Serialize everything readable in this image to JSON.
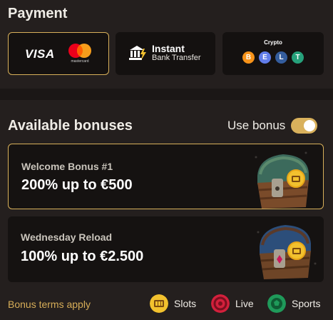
{
  "payment": {
    "title": "Payment",
    "methods": [
      {
        "id": "cards",
        "visa": "VISA",
        "mastercard": "mastercard",
        "selected": true
      },
      {
        "id": "bank",
        "title": "Instant",
        "subtitle": "Bank Transfer",
        "selected": false
      },
      {
        "id": "crypto",
        "title": "Crypto",
        "coins": [
          "B",
          "E",
          "L",
          "T"
        ],
        "selected": false
      }
    ]
  },
  "bonuses": {
    "title": "Available bonuses",
    "use_bonus_label": "Use bonus",
    "use_bonus_enabled": true,
    "items": [
      {
        "name": "Welcome Bonus #1",
        "value": "200% up to €500",
        "selected": true
      },
      {
        "name": "Wednesday Reload",
        "value": "100% up to €2.500",
        "selected": false
      }
    ]
  },
  "footer": {
    "terms": "Bonus terms apply",
    "categories": [
      {
        "label": "Slots",
        "icon": "slots-icon"
      },
      {
        "label": "Live",
        "icon": "live-icon"
      },
      {
        "label": "Sports",
        "icon": "sports-icon"
      }
    ]
  },
  "colors": {
    "accent": "#d8b05a",
    "background": "#1b1716",
    "panel": "#241f1e",
    "card": "#151211"
  }
}
